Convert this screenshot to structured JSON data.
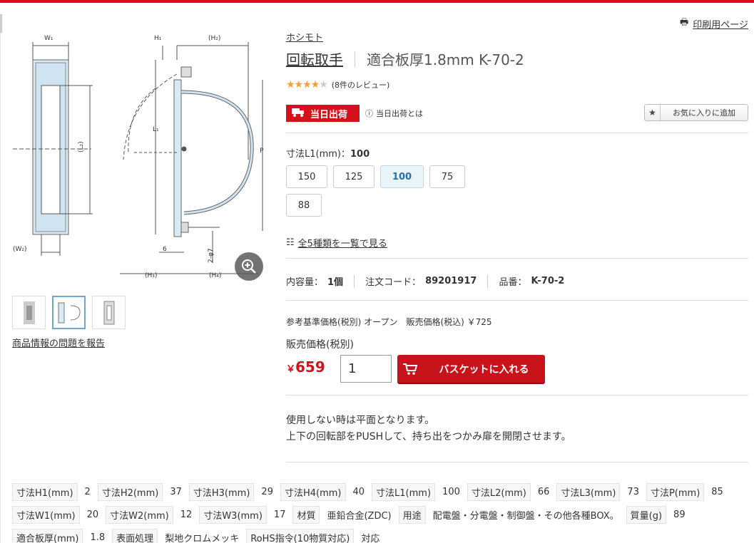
{
  "print_label": "印刷用ページ",
  "brand": "ホシモト",
  "title": {
    "name": "回転取手",
    "subtitle": "適合板厚1.8mm K-70-2"
  },
  "rating": {
    "stars": 4,
    "max": 5,
    "review_text": "(8件のレビュー)"
  },
  "same_day": {
    "badge": "当日出荷",
    "info": "当日出荷とは"
  },
  "favorite_label": "お気に入りに追加",
  "size": {
    "label": "寸法L1(mm)：",
    "selected": "100",
    "options": [
      "150",
      "125",
      "100",
      "75",
      "88"
    ]
  },
  "list_link": "全5種類を一覧で見る",
  "meta": {
    "content_label": "内容量：",
    "content_value": "1個",
    "code_label": "注文コード：",
    "code_value": "89201917",
    "part_label": "品番：",
    "part_value": "K-70-2"
  },
  "ref_price": "参考基準価格(税別) オープン　販売価格(税込) ￥725",
  "sales_label": "販売価格(税別)",
  "price": {
    "currency": "￥",
    "value": "659"
  },
  "quantity": "1",
  "basket_label": "バスケットに入れる",
  "description": [
    "使用しない時は平面となります。",
    "上下の回転部をPUSHして、持ち出をつかみ扉を開閉させます。"
  ],
  "report_label": "商品情報の問題を報告",
  "drawing_labels": {
    "w1": "W₁",
    "w2": "(W₂)",
    "h1": "H₁",
    "h2": "(H₂)",
    "h3": "(H₃)",
    "h4": "(H₄)",
    "l1": "L₁",
    "l2": "(L₂)",
    "p": "P",
    "six": "6",
    "hole": "2-φ7"
  },
  "specs": [
    [
      [
        "寸法H1(mm)",
        "2"
      ],
      [
        "寸法H2(mm)",
        "37"
      ],
      [
        "寸法H3(mm)",
        "29"
      ],
      [
        "寸法H4(mm)",
        "40"
      ],
      [
        "寸法L1(mm)",
        "100"
      ],
      [
        "寸法L2(mm)",
        "66"
      ],
      [
        "寸法L3(mm)",
        "73"
      ],
      [
        "寸法P(mm)",
        "85"
      ]
    ],
    [
      [
        "寸法W1(mm)",
        "20"
      ],
      [
        "寸法W2(mm)",
        "12"
      ],
      [
        "寸法W3(mm)",
        "17"
      ],
      [
        "材質",
        "亜鉛合金(ZDC)"
      ],
      [
        "用途",
        "配電盤・分電盤・制御盤・その他各種BOX。"
      ],
      [
        "質量(g)",
        "89"
      ]
    ],
    [
      [
        "適合板厚(mm)",
        "1.8"
      ],
      [
        "表面処理",
        "梨地クロムメッキ"
      ],
      [
        "RoHS指令(10物質対応)",
        "対応"
      ]
    ]
  ],
  "colors": {
    "accent": "#d5121b",
    "star": "#f0a22e",
    "selected_bg": "#e9f3fa",
    "selected_text": "#2a6fa5"
  }
}
